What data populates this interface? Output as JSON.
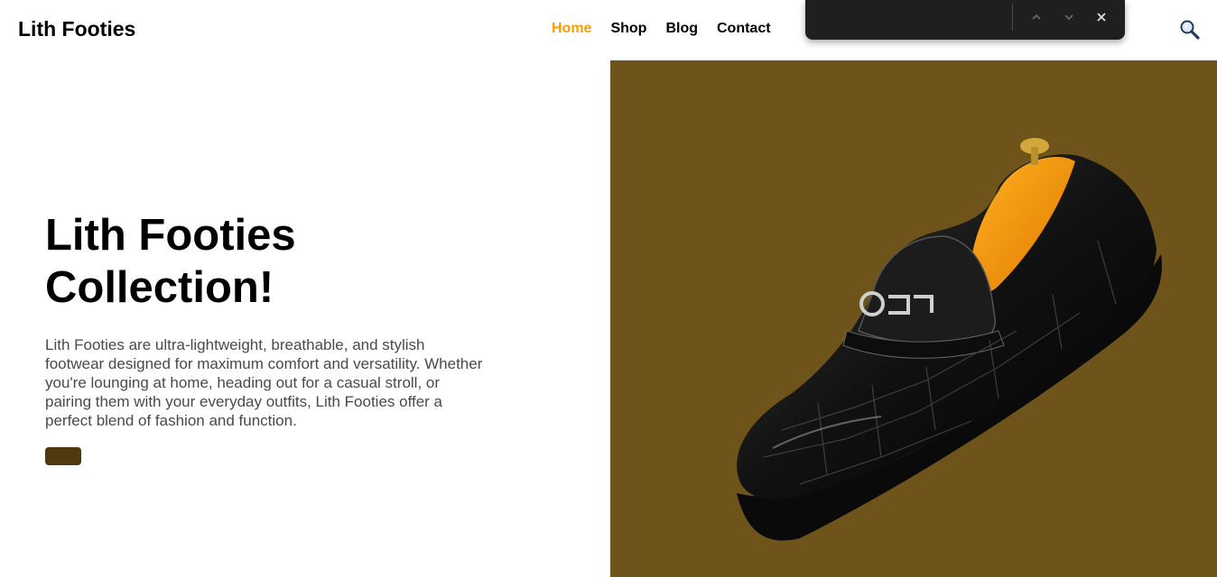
{
  "header": {
    "logo": "Lith Footies",
    "nav": [
      {
        "label": "Home",
        "active": true
      },
      {
        "label": "Shop",
        "active": false
      },
      {
        "label": "Blog",
        "active": false
      },
      {
        "label": "Contact",
        "active": false
      }
    ],
    "search_icon": "magnifier-icon"
  },
  "findbar": {
    "prev_icon": "chevron-up-icon",
    "next_icon": "chevron-down-icon",
    "close_icon": "close-icon"
  },
  "hero": {
    "title_line1": "Lith Footies",
    "title_line2": "Collection!",
    "description": "Lith Footies are ultra-lightweight, breathable, and stylish footwear designed for maximum comfort and versatility. Whether you're lounging at home, heading out for a casual stroll, or pairing them with your everyday outfits, Lith Footies offer a perfect blend of fashion and function.",
    "button_label": "",
    "image": "black-croc-loafer-shoe"
  },
  "colors": {
    "accent": "#f5a000",
    "hero_bg": "#6e541b",
    "button": "#4e3a0e"
  }
}
